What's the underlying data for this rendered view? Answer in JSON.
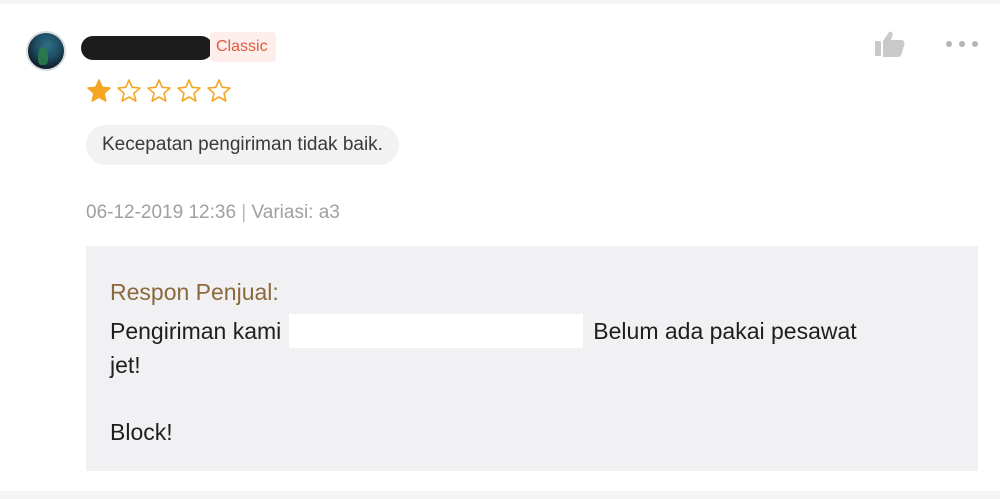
{
  "review": {
    "badge": "Classic",
    "rating": 1,
    "rating_max": 5,
    "tag": "Kecepatan pengiriman tidak baik.",
    "date": "06-12-2019 12:36",
    "separator": "|",
    "variation": "Variasi: a3",
    "icons": {
      "like": "thumbs-up-icon",
      "more": "more-horizontal-icon",
      "star_filled": "star-filled-icon",
      "star_empty": "star-outline-icon"
    },
    "colors": {
      "star": "#f5a623",
      "badge_text": "#e05a3f",
      "badge_bg": "#fdeeec",
      "seller_label": "#8a6a3c"
    }
  },
  "seller_reply": {
    "label": "Respon Penjual:",
    "line1_prefix": "Pengiriman kami",
    "line1_suffix": "Belum ada pakai pesawat",
    "line2": "jet!",
    "line3": "Block!"
  }
}
